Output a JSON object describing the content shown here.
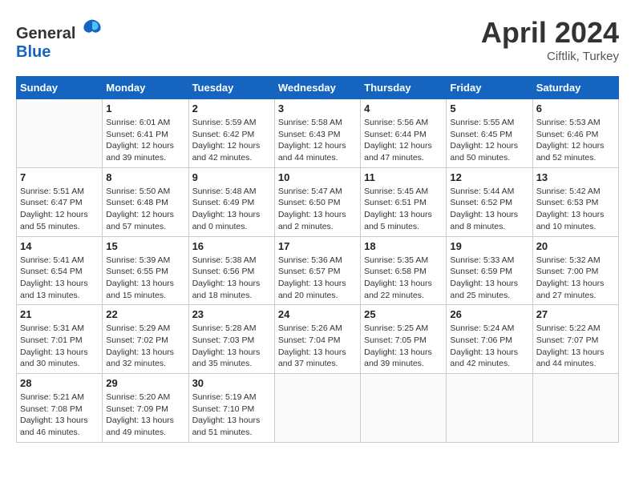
{
  "header": {
    "logo_general": "General",
    "logo_blue": "Blue",
    "month_title": "April 2024",
    "subtitle": "Ciftlik, Turkey"
  },
  "days_of_week": [
    "Sunday",
    "Monday",
    "Tuesday",
    "Wednesday",
    "Thursday",
    "Friday",
    "Saturday"
  ],
  "weeks": [
    [
      {
        "day": "",
        "info": ""
      },
      {
        "day": "1",
        "info": "Sunrise: 6:01 AM\nSunset: 6:41 PM\nDaylight: 12 hours\nand 39 minutes."
      },
      {
        "day": "2",
        "info": "Sunrise: 5:59 AM\nSunset: 6:42 PM\nDaylight: 12 hours\nand 42 minutes."
      },
      {
        "day": "3",
        "info": "Sunrise: 5:58 AM\nSunset: 6:43 PM\nDaylight: 12 hours\nand 44 minutes."
      },
      {
        "day": "4",
        "info": "Sunrise: 5:56 AM\nSunset: 6:44 PM\nDaylight: 12 hours\nand 47 minutes."
      },
      {
        "day": "5",
        "info": "Sunrise: 5:55 AM\nSunset: 6:45 PM\nDaylight: 12 hours\nand 50 minutes."
      },
      {
        "day": "6",
        "info": "Sunrise: 5:53 AM\nSunset: 6:46 PM\nDaylight: 12 hours\nand 52 minutes."
      }
    ],
    [
      {
        "day": "7",
        "info": "Sunrise: 5:51 AM\nSunset: 6:47 PM\nDaylight: 12 hours\nand 55 minutes."
      },
      {
        "day": "8",
        "info": "Sunrise: 5:50 AM\nSunset: 6:48 PM\nDaylight: 12 hours\nand 57 minutes."
      },
      {
        "day": "9",
        "info": "Sunrise: 5:48 AM\nSunset: 6:49 PM\nDaylight: 13 hours\nand 0 minutes."
      },
      {
        "day": "10",
        "info": "Sunrise: 5:47 AM\nSunset: 6:50 PM\nDaylight: 13 hours\nand 2 minutes."
      },
      {
        "day": "11",
        "info": "Sunrise: 5:45 AM\nSunset: 6:51 PM\nDaylight: 13 hours\nand 5 minutes."
      },
      {
        "day": "12",
        "info": "Sunrise: 5:44 AM\nSunset: 6:52 PM\nDaylight: 13 hours\nand 8 minutes."
      },
      {
        "day": "13",
        "info": "Sunrise: 5:42 AM\nSunset: 6:53 PM\nDaylight: 13 hours\nand 10 minutes."
      }
    ],
    [
      {
        "day": "14",
        "info": "Sunrise: 5:41 AM\nSunset: 6:54 PM\nDaylight: 13 hours\nand 13 minutes."
      },
      {
        "day": "15",
        "info": "Sunrise: 5:39 AM\nSunset: 6:55 PM\nDaylight: 13 hours\nand 15 minutes."
      },
      {
        "day": "16",
        "info": "Sunrise: 5:38 AM\nSunset: 6:56 PM\nDaylight: 13 hours\nand 18 minutes."
      },
      {
        "day": "17",
        "info": "Sunrise: 5:36 AM\nSunset: 6:57 PM\nDaylight: 13 hours\nand 20 minutes."
      },
      {
        "day": "18",
        "info": "Sunrise: 5:35 AM\nSunset: 6:58 PM\nDaylight: 13 hours\nand 22 minutes."
      },
      {
        "day": "19",
        "info": "Sunrise: 5:33 AM\nSunset: 6:59 PM\nDaylight: 13 hours\nand 25 minutes."
      },
      {
        "day": "20",
        "info": "Sunrise: 5:32 AM\nSunset: 7:00 PM\nDaylight: 13 hours\nand 27 minutes."
      }
    ],
    [
      {
        "day": "21",
        "info": "Sunrise: 5:31 AM\nSunset: 7:01 PM\nDaylight: 13 hours\nand 30 minutes."
      },
      {
        "day": "22",
        "info": "Sunrise: 5:29 AM\nSunset: 7:02 PM\nDaylight: 13 hours\nand 32 minutes."
      },
      {
        "day": "23",
        "info": "Sunrise: 5:28 AM\nSunset: 7:03 PM\nDaylight: 13 hours\nand 35 minutes."
      },
      {
        "day": "24",
        "info": "Sunrise: 5:26 AM\nSunset: 7:04 PM\nDaylight: 13 hours\nand 37 minutes."
      },
      {
        "day": "25",
        "info": "Sunrise: 5:25 AM\nSunset: 7:05 PM\nDaylight: 13 hours\nand 39 minutes."
      },
      {
        "day": "26",
        "info": "Sunrise: 5:24 AM\nSunset: 7:06 PM\nDaylight: 13 hours\nand 42 minutes."
      },
      {
        "day": "27",
        "info": "Sunrise: 5:22 AM\nSunset: 7:07 PM\nDaylight: 13 hours\nand 44 minutes."
      }
    ],
    [
      {
        "day": "28",
        "info": "Sunrise: 5:21 AM\nSunset: 7:08 PM\nDaylight: 13 hours\nand 46 minutes."
      },
      {
        "day": "29",
        "info": "Sunrise: 5:20 AM\nSunset: 7:09 PM\nDaylight: 13 hours\nand 49 minutes."
      },
      {
        "day": "30",
        "info": "Sunrise: 5:19 AM\nSunset: 7:10 PM\nDaylight: 13 hours\nand 51 minutes."
      },
      {
        "day": "",
        "info": ""
      },
      {
        "day": "",
        "info": ""
      },
      {
        "day": "",
        "info": ""
      },
      {
        "day": "",
        "info": ""
      }
    ]
  ]
}
